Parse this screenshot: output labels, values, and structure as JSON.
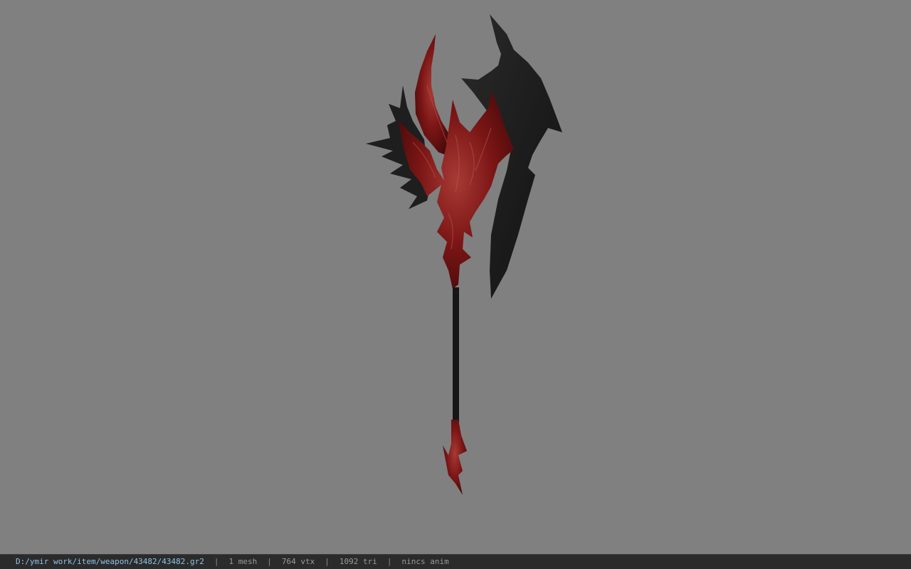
{
  "viewer": {
    "background_color": "#808080",
    "model": {
      "description_icon": "axe-model-icon",
      "colors": {
        "blade_dark": "#1c1c1c",
        "flesh_red": "#7a1515",
        "flesh_highlight": "#a83a34",
        "shaft": "#161616"
      }
    }
  },
  "status_bar": {
    "file_path": "D:/ymir work/item/weapon/43482/43482.gr2",
    "separator": "|",
    "mesh_count": "1 mesh",
    "vertex_count": "764 vtx",
    "triangle_count": "1092 tri",
    "anim_status": "nincs anim"
  }
}
